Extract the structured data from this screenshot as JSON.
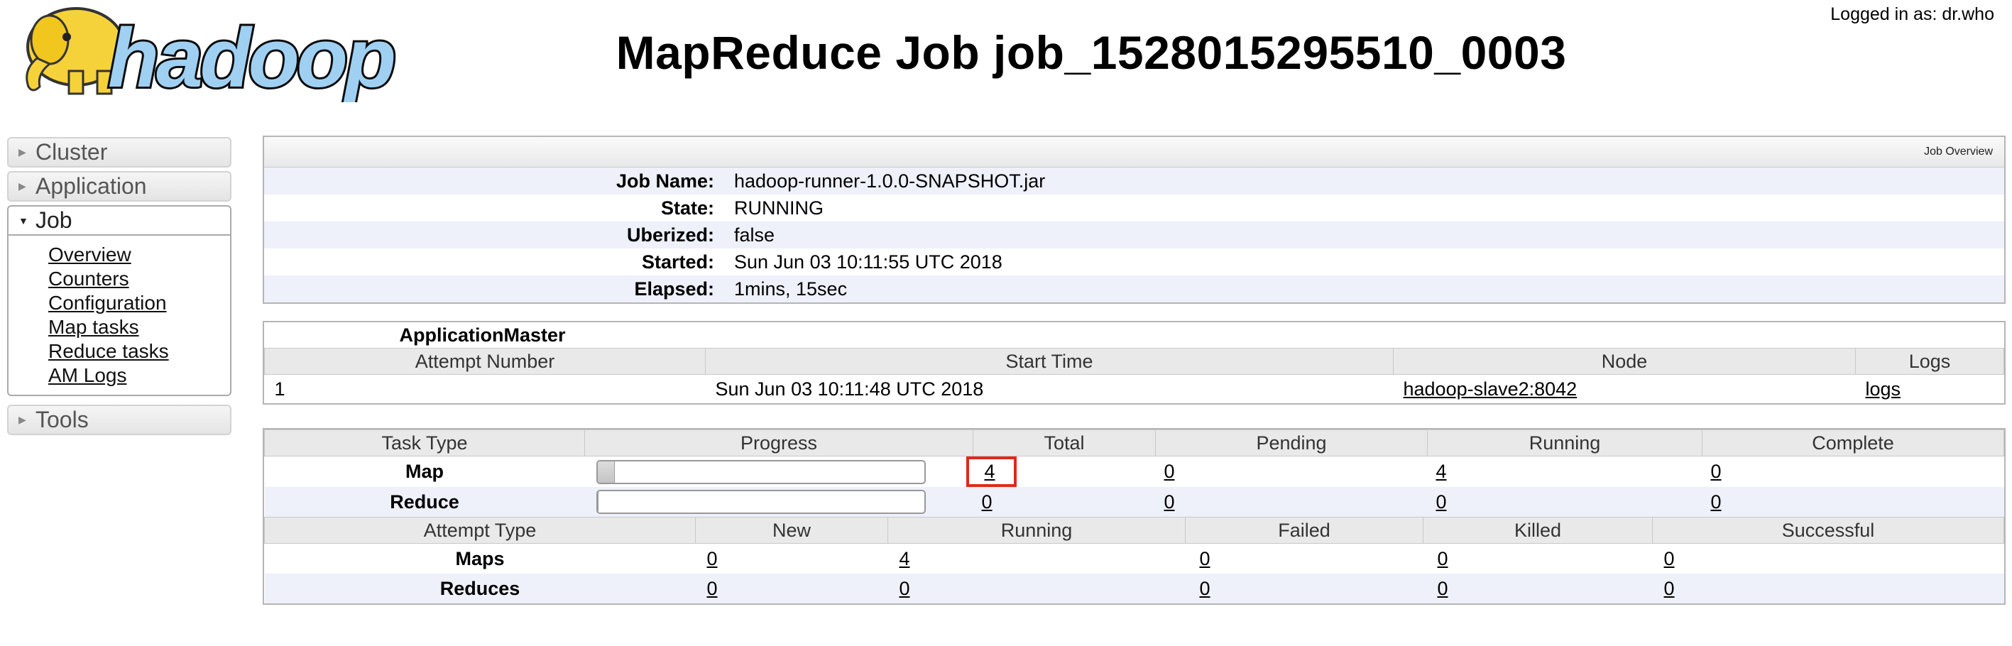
{
  "header": {
    "logo_text": "hadoop",
    "title": "MapReduce Job job_1528015295510_0003",
    "login": "Logged in as: dr.who"
  },
  "nav": {
    "sections": [
      {
        "label": "Cluster",
        "expanded": false
      },
      {
        "label": "Application",
        "expanded": false
      },
      {
        "label": "Job",
        "expanded": true
      },
      {
        "label": "Tools",
        "expanded": false
      }
    ],
    "job_links": [
      "Overview",
      "Counters",
      "Configuration",
      "Map tasks",
      "Reduce tasks",
      "AM Logs"
    ]
  },
  "overview": {
    "heading": "Job Overview",
    "rows": [
      {
        "key": "Job Name:",
        "value": "hadoop-runner-1.0.0-SNAPSHOT.jar"
      },
      {
        "key": "State:",
        "value": "RUNNING"
      },
      {
        "key": "Uberized:",
        "value": "false"
      },
      {
        "key": "Started:",
        "value": "Sun Jun 03 10:11:55 UTC 2018"
      },
      {
        "key": "Elapsed:",
        "value": "1mins, 15sec"
      }
    ]
  },
  "app_master": {
    "caption": "ApplicationMaster",
    "headers": [
      "Attempt Number",
      "Start Time",
      "Node",
      "Logs"
    ],
    "row": {
      "attempt": "1",
      "start": "Sun Jun 03 10:11:48 UTC 2018",
      "node": "hadoop-slave2:8042",
      "logs": "logs"
    }
  },
  "tasks": {
    "headers": [
      "Task Type",
      "Progress",
      "Total",
      "Pending",
      "Running",
      "Complete"
    ],
    "rows": [
      {
        "type": "Map",
        "progress": 0.05,
        "total": "4",
        "pending": "0",
        "running": "4",
        "complete": "0"
      },
      {
        "type": "Reduce",
        "progress": 0,
        "total": "0",
        "pending": "0",
        "running": "0",
        "complete": "0"
      }
    ],
    "highlight_color": "#e0291b"
  },
  "attempts": {
    "headers": [
      "Attempt Type",
      "New",
      "Running",
      "Failed",
      "Killed",
      "Successful"
    ],
    "rows": [
      {
        "type": "Maps",
        "new": "0",
        "running": "4",
        "failed": "0",
        "killed": "0",
        "successful": "0"
      },
      {
        "type": "Reduces",
        "new": "0",
        "running": "0",
        "failed": "0",
        "killed": "0",
        "successful": "0"
      }
    ]
  }
}
